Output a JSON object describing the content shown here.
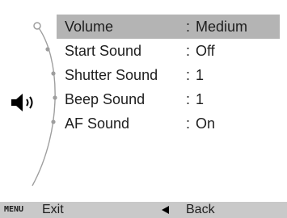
{
  "menu": {
    "items": [
      {
        "label": "Volume",
        "separator": ":",
        "value": "Medium",
        "selected": true
      },
      {
        "label": "Start Sound",
        "separator": ":",
        "value": "Off",
        "selected": false
      },
      {
        "label": "Shutter Sound",
        "separator": ":",
        "value": "1",
        "selected": false
      },
      {
        "label": "Beep Sound",
        "separator": ":",
        "value": "1",
        "selected": false
      },
      {
        "label": "AF Sound",
        "separator": ":",
        "value": "On",
        "selected": false
      }
    ]
  },
  "section_icon": "speaker-icon",
  "bottom_bar": {
    "menu_key": "MENU",
    "exit_label": "Exit",
    "back_icon": "left-arrow-icon",
    "back_label": "Back"
  },
  "colors": {
    "selected_row": "#b4b4b4",
    "bottom_bar": "#c9c9c9",
    "background": "#ffffff"
  }
}
